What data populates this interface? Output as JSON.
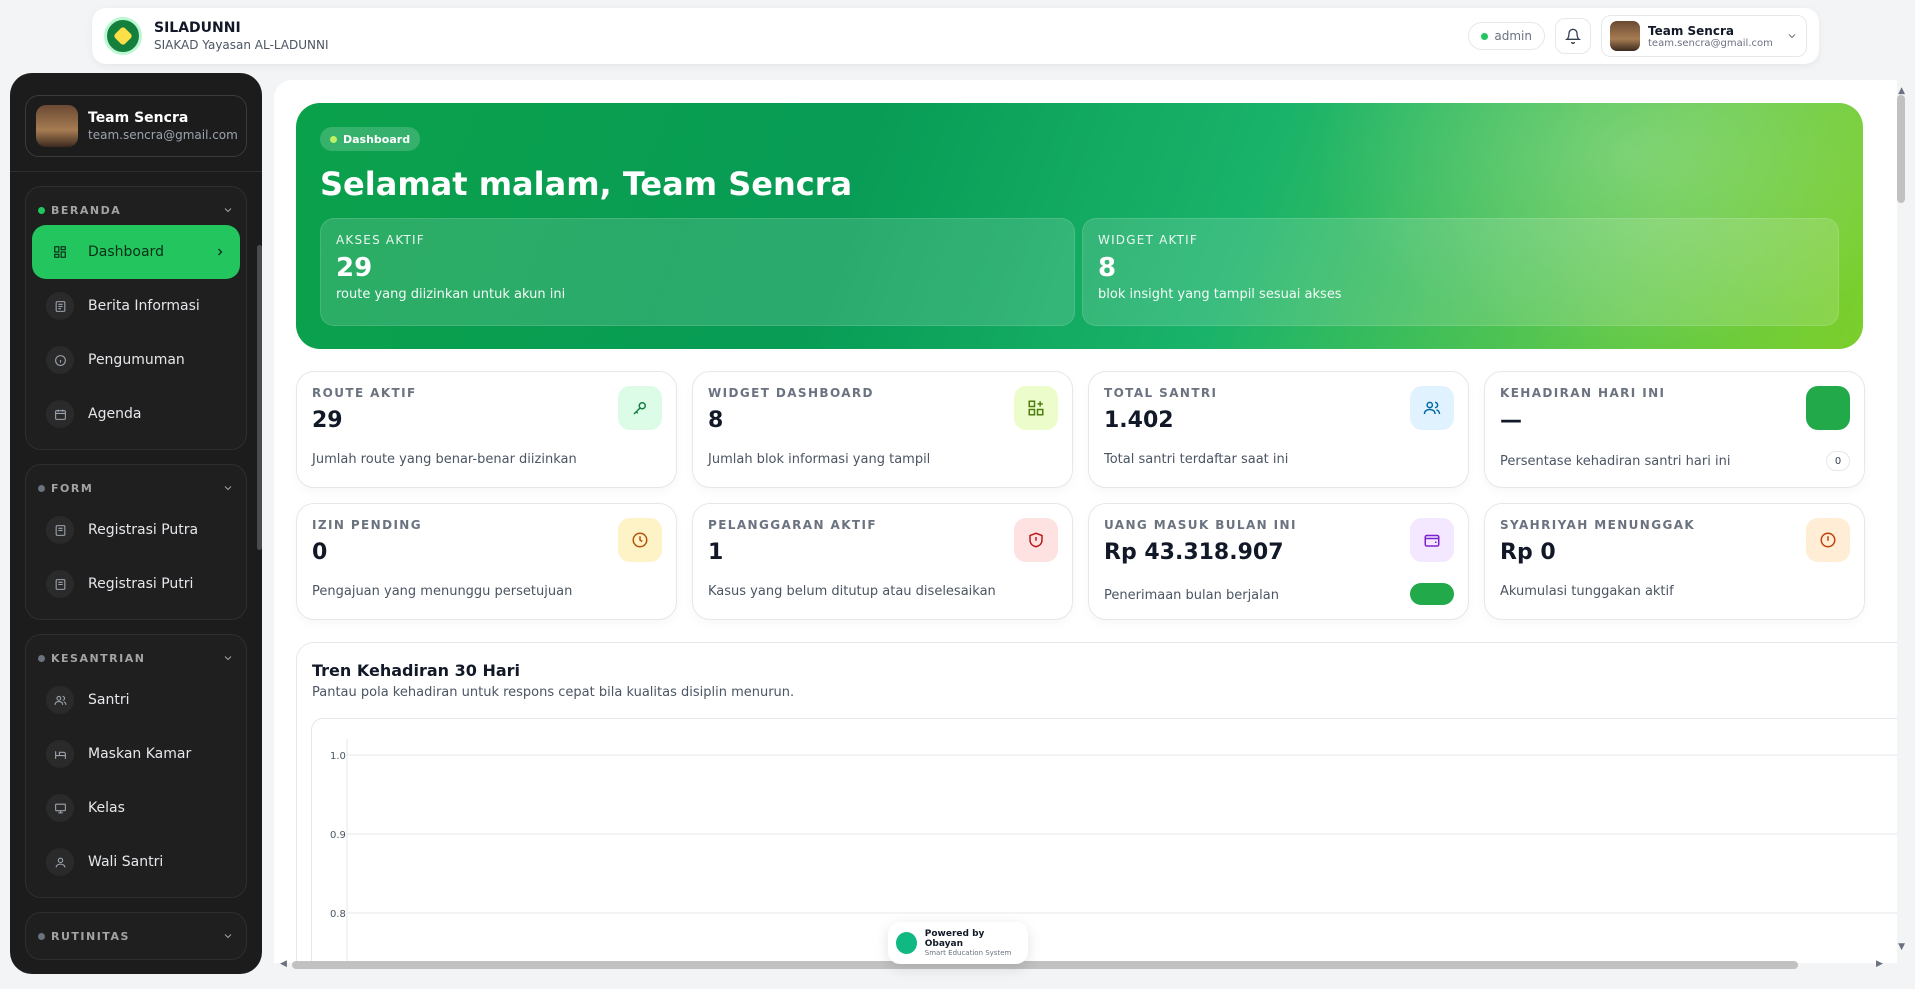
{
  "topbar": {
    "app_name": "SILADUNNI",
    "app_sub": "SIAKAD Yayasan AL-LADUNNI",
    "role": "admin",
    "user_name": "Team Sencra",
    "user_email": "team.sencra@gmail.com"
  },
  "sidebar": {
    "profile_name": "Team Sencra",
    "profile_email": "team.sencra@gmail.com",
    "groups": [
      {
        "label": "BERANDA",
        "items": [
          {
            "label": "Dashboard",
            "icon": "dashboard-icon",
            "active": true
          },
          {
            "label": "Berita Informasi",
            "icon": "news-icon"
          },
          {
            "label": "Pengumuman",
            "icon": "info-icon"
          },
          {
            "label": "Agenda",
            "icon": "calendar-icon"
          }
        ]
      },
      {
        "label": "FORM",
        "items": [
          {
            "label": "Registrasi Putra",
            "icon": "form-icon"
          },
          {
            "label": "Registrasi Putri",
            "icon": "form-icon"
          }
        ]
      },
      {
        "label": "KESANTRIAN",
        "items": [
          {
            "label": "Santri",
            "icon": "users-icon"
          },
          {
            "label": "Maskan Kamar",
            "icon": "bed-icon"
          },
          {
            "label": "Kelas",
            "icon": "class-icon"
          },
          {
            "label": "Wali Santri",
            "icon": "user-icon"
          }
        ]
      },
      {
        "label": "RUTINITAS",
        "items": []
      }
    ]
  },
  "hero": {
    "badge": "Dashboard",
    "greeting": "Selamat malam, Team Sencra",
    "cards": [
      {
        "label": "AKSES AKTIF",
        "value": "29",
        "desc": "route yang diizinkan untuk akun ini"
      },
      {
        "label": "WIDGET AKTIF",
        "value": "8",
        "desc": "blok insight yang tampil sesuai akses"
      }
    ]
  },
  "stats": [
    {
      "label": "ROUTE AKTIF",
      "value": "29",
      "desc": "Jumlah route yang benar-benar diizinkan",
      "icon": "key-icon",
      "color": "#dcfce7"
    },
    {
      "label": "WIDGET DASHBOARD",
      "value": "8",
      "desc": "Jumlah blok informasi yang tampil",
      "icon": "widget-icon",
      "color": "#ecfccb"
    },
    {
      "label": "TOTAL SANTRI",
      "value": "1.402",
      "desc": "Total santri terdaftar saat ini",
      "icon": "users-icon",
      "color": "#e0f2fe"
    },
    {
      "label": "KEHADIRAN HARI INI",
      "value": "—",
      "desc": "Persentase kehadiran santri hari ini",
      "icon": "attendance-icon",
      "color": "#22a94a",
      "pill": "0"
    },
    {
      "label": "IZIN PENDING",
      "value": "0",
      "desc": "Pengajuan yang menunggu persetujuan",
      "icon": "clock-icon",
      "color": "#fef3c7"
    },
    {
      "label": "PELANGGARAN AKTIF",
      "value": "1",
      "desc": "Kasus yang belum ditutup atau diselesaikan",
      "icon": "shield-alert-icon",
      "color": "#fee2e2"
    },
    {
      "label": "UANG MASUK BULAN INI",
      "value": "Rp 43.318.907",
      "desc": "Penerimaan bulan berjalan",
      "icon": "wallet-icon",
      "color": "#f3e8ff"
    },
    {
      "label": "SYAHRIYAH MENUNGGAK",
      "value": "Rp 0",
      "desc": "Akumulasi tunggakan aktif",
      "icon": "alert-circle-icon",
      "color": "#ffedd5"
    }
  ],
  "chart": {
    "title": "Tren Kehadiran 30 Hari",
    "subtitle": "Pantau pola kehadiran untuk respons cepat bila kualitas disiplin menurun."
  },
  "chart_data": {
    "type": "line",
    "title": "Tren Kehadiran 30 Hari",
    "yticks": [
      "1.0",
      "0.9",
      "0.8"
    ],
    "ylim": [
      0.8,
      1.0
    ],
    "grid": true,
    "series": []
  },
  "footer": {
    "powered": "Powered by Obayan",
    "powered_sub": "Smart Education System"
  }
}
